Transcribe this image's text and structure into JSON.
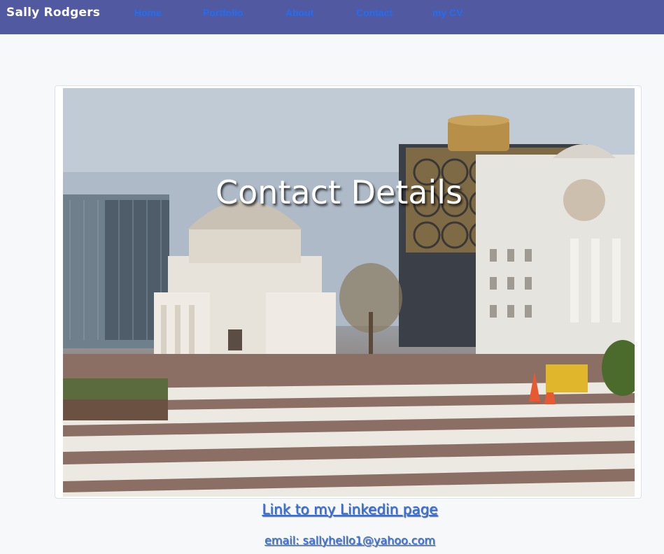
{
  "navbar": {
    "brand": "Sally Rodgers",
    "links": [
      {
        "label": "Home"
      },
      {
        "label": "Portfolio"
      },
      {
        "label": "About"
      },
      {
        "label": "Contact"
      },
      {
        "label": "my CV"
      }
    ]
  },
  "hero": {
    "title": "Contact Details"
  },
  "contact": {
    "linkedin_label": "Link to my Linkedin page",
    "email_label": "email: sallyhello1@yahoo.com"
  },
  "colors": {
    "navbar_bg": "#5159a1",
    "nav_link": "#1f6ef5",
    "page_bg": "#f7f8fa",
    "link": "#2a6ff0"
  }
}
